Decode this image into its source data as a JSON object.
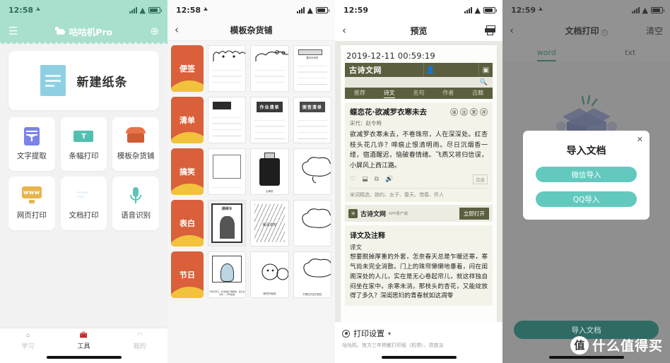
{
  "panel1": {
    "status": {
      "time": "12:58"
    },
    "header": {
      "title": "咕咕机Pro",
      "left_icon": "menu-icon",
      "right_icon": "plus-circle-icon"
    },
    "new_note": {
      "label": "新建纸条",
      "icon": "note-icon"
    },
    "features": [
      {
        "label": "文字提取",
        "icon": "text-extract-icon"
      },
      {
        "label": "条幅打印",
        "icon": "banner-print-icon"
      },
      {
        "label": "模板杂货铺",
        "icon": "template-shop-icon"
      },
      {
        "label": "网页打印",
        "icon": "web-print-icon"
      },
      {
        "label": "文档打印",
        "icon": "document-print-icon"
      },
      {
        "label": "语音识别",
        "icon": "voice-recognition-icon"
      }
    ],
    "tabbar": [
      {
        "label": "学习",
        "icon": "home-icon",
        "active": false
      },
      {
        "label": "工具",
        "icon": "toolbox-icon",
        "active": true
      },
      {
        "label": "我的",
        "icon": "person-icon",
        "active": false
      }
    ]
  },
  "panel2": {
    "status": {
      "time": "12:58"
    },
    "nav": {
      "title": "模板杂货铺",
      "back": "‹"
    },
    "rows": [
      {
        "category": "便签",
        "thumbs": [
          {
            "caption": "",
            "style": "sketch-crown"
          },
          {
            "caption": "",
            "style": "sketch-frog"
          },
          {
            "caption": "要自未来的",
            "style": "doc-card"
          }
        ]
      },
      {
        "category": "清单",
        "thumbs": [
          {
            "caption": "",
            "style": "date-box"
          },
          {
            "caption": "作业清单",
            "style": "banner-title"
          },
          {
            "caption": "面签清单",
            "style": "banner-title"
          }
        ]
      },
      {
        "category": "搞笑",
        "thumbs": [
          {
            "caption": "",
            "style": "dialog-card"
          },
          {
            "caption": "后悔药",
            "style": "bottle"
          },
          {
            "caption": "",
            "style": "sketch-cloud"
          }
        ]
      },
      {
        "category": "表白",
        "thumbs": [
          {
            "caption": "通缉令",
            "style": "poster"
          },
          {
            "caption": "我喜欢你",
            "style": "text-wall"
          },
          {
            "caption": "",
            "style": "sketch-cloud"
          }
        ]
      },
      {
        "category": "节日",
        "thumbs": [
          {
            "caption": "不到打学习，考试成绩不理想等，要认真对待——开学寄语",
            "style": "window"
          },
          {
            "caption": "新的开始啦",
            "style": "kids"
          },
          {
            "caption": "不想压岁还的钱包",
            "style": "sketch-cloud"
          }
        ]
      }
    ]
  },
  "panel3": {
    "status": {
      "time": "12:59"
    },
    "nav": {
      "title": "预览",
      "back": "‹",
      "print_icon": "printer-icon"
    },
    "paper": {
      "timestamp": "2019-12-11 00:59:19",
      "site_title": "古诗文网",
      "site_icons": [
        "user-icon",
        "bookmark-icon"
      ],
      "search_icon": "search-icon",
      "tabs": [
        "推荐",
        "诗文",
        "名句",
        "作者",
        "古籍"
      ],
      "active_tab": "诗文",
      "poem": {
        "title": "蝶恋花·欲减罗衣寒未去",
        "buttons": [
          "译",
          "注",
          "赏",
          "评"
        ],
        "meta": "宋代：赵令畤",
        "body": "欲减罗衣寒未去，不卷珠帘，人在深深处。红杏枝头花几许？啼痕止恨清明雨。尽日沉烟香一缕，宿酒醒迟，恼破春情绪。飞燕又将归信误，小屏风上西江路。",
        "actions": [
          "heart-icon",
          "download-icon",
          "copy-icon",
          "sound-icon"
        ],
        "action_badge": "完善",
        "tags": "宋词精选、婉约、女子、春天、惜春、怀人"
      },
      "app_banner": {
        "name": "古诗文网",
        "subtitle": "APP客户端",
        "button": "立即打开"
      },
      "translation": {
        "heading": "译文及注释",
        "sub": "译文",
        "body": "想要脱掉厚重的外套，怎奈春天总是乍暖还寒，寒气尚未完全消散。门上的珠帘懒懒地垂着，闷在闺阁深处的人儿，实在是无心卷起帘儿，就这样独自闷坐在家中。余寒未消，那枝头的杏花，又能绽放得了多久？深闺思妇的青春就如这凋零"
      }
    },
    "print_settings": {
      "label": "打印设置",
      "subtitle": "咕咕机、官方三年热敏打印纸（机带）、浓度淡"
    }
  },
  "panel4": {
    "status": {
      "time": "12:59"
    },
    "nav": {
      "title": "文档打印",
      "back": "‹",
      "clear": "清空",
      "info_icon": "info-icon"
    },
    "tabs": [
      {
        "label": "word",
        "active": true
      },
      {
        "label": "txt",
        "active": false
      }
    ],
    "empty_icon": "empty-box-icon",
    "modal": {
      "title": "导入文档",
      "close": "✕",
      "buttons": [
        "微信导入",
        "QQ导入"
      ]
    },
    "cta": "导入文档",
    "watermark": {
      "badge": "值",
      "text": "什么值得买"
    }
  },
  "colors": {
    "teal_header": "#a8e0cd",
    "accent_teal": "#63c9bf",
    "cta_dark": "#2f6b63",
    "category_orange": "#d9603a",
    "category_yellow": "#f2c23c",
    "poem_olive": "#5c5f3f"
  }
}
